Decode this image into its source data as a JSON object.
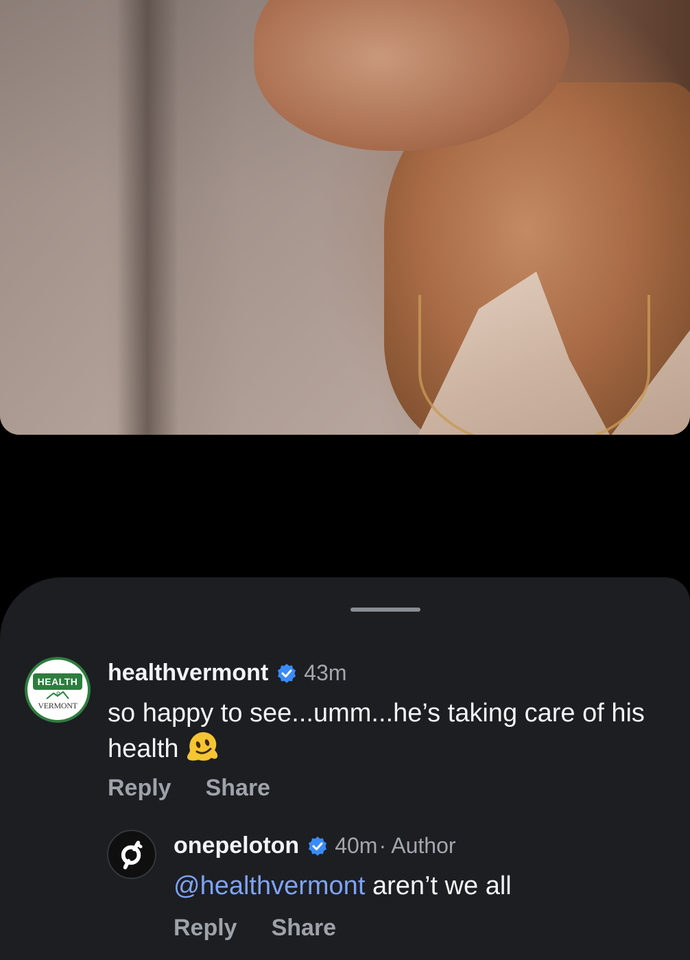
{
  "colors": {
    "background": "#000000",
    "sheet": "#1c1e22",
    "text_primary": "#f2f3f5",
    "text_secondary": "#a3a7ad",
    "action": "#9ea3a9",
    "mention": "#7fa3f5",
    "verified": "#3a8bf7",
    "health_green": "#2e7d3e"
  },
  "video": {
    "icon": "video-frame"
  },
  "comments": [
    {
      "username": "healthvermont",
      "verified": true,
      "time": "43m",
      "text": "so happy to see...umm...he’s taking care of his health",
      "emoji": "melting-face-emoji",
      "avatar": {
        "top_text": "HEALTH",
        "bottom_text": "VERMONT"
      },
      "actions": {
        "reply": "Reply",
        "share": "Share"
      }
    },
    {
      "username": "onepeloton",
      "verified": true,
      "time": "40m",
      "author_label": "· Author",
      "mention": "@healthvermont",
      "text": " aren’t we all",
      "avatar": {
        "icon": "peloton-logo-icon"
      },
      "actions": {
        "reply": "Reply",
        "share": "Share"
      }
    }
  ]
}
